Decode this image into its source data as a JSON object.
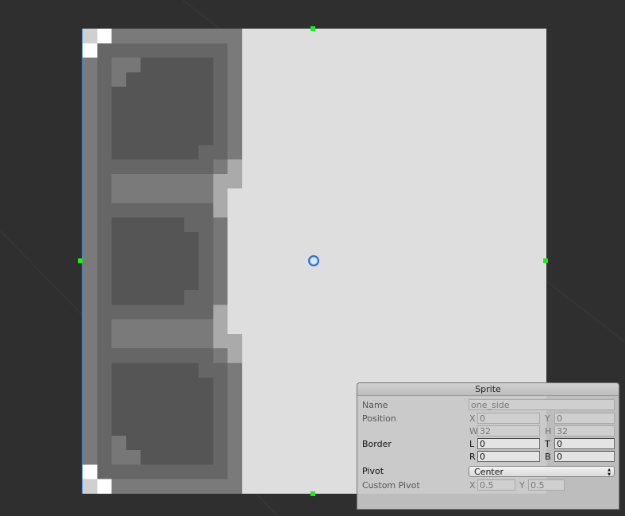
{
  "panel": {
    "title": "Sprite",
    "name_label": "Name",
    "name_value": "one_side",
    "position_label": "Position",
    "x_label": "X",
    "x_value": "0",
    "y_label": "Y",
    "y_value": "0",
    "w_label": "W",
    "w_value": "32",
    "h_label": "H",
    "h_value": "32",
    "border_label": "Border",
    "l_label": "L",
    "l_value": "0",
    "t_label": "T",
    "t_value": "0",
    "r_label": "R",
    "r_value": "0",
    "b_label": "B",
    "b_value": "0",
    "pivot_label": "Pivot",
    "pivot_value": "Center",
    "custom_pivot_label": "Custom Pivot",
    "cpx_label": "X",
    "cpx_value": "0.5",
    "cpy_label": "Y",
    "cpy_value": "0.5"
  },
  "colors": {
    "selection": "#3d86d6",
    "handle": "#16f016"
  }
}
